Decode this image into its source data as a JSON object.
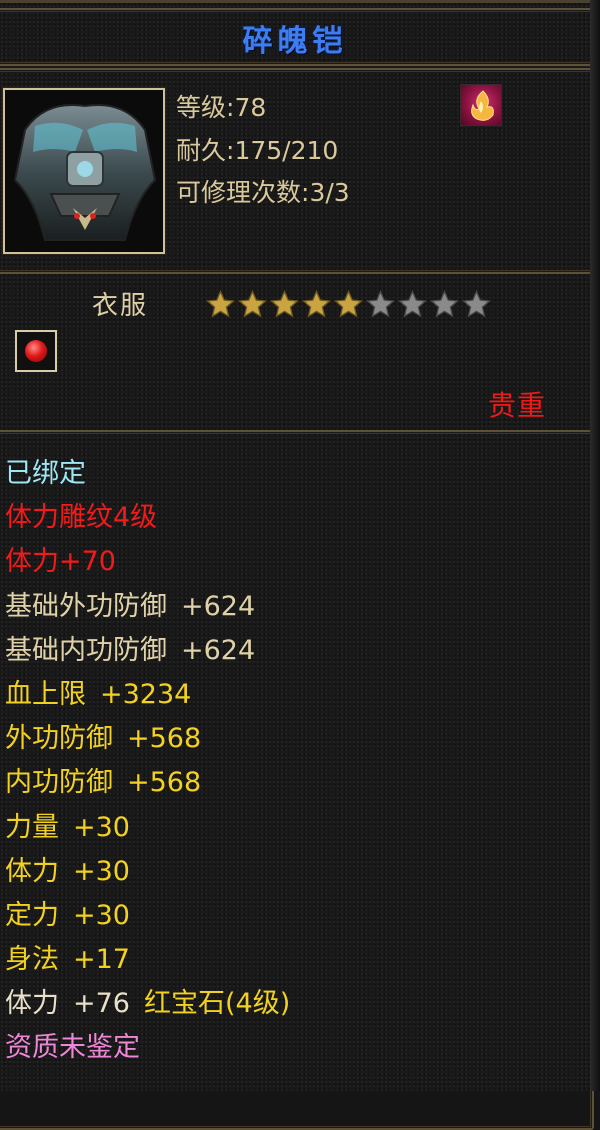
{
  "title": "碎魄铠",
  "header": {
    "level_label": "等级:",
    "level_value": "78",
    "durability_label": "耐久:",
    "durability_value": "175/210",
    "repair_label": "可修理次数:",
    "repair_value": "3/3",
    "quality_icon": "flame-quality-icon"
  },
  "type": {
    "label": "衣服",
    "stars_total": 9,
    "stars_filled": 5,
    "stars_filled_color": "#c9a441",
    "stars_empty_color": "#8a8a8a"
  },
  "socket": {
    "gem_icon": "red-gem-icon",
    "gem_color": "#e01818"
  },
  "bind_note": "贵重",
  "attributes": [
    {
      "text": "已绑定",
      "value": "",
      "style": "bound"
    },
    {
      "text": "体力雕纹4级",
      "value": "",
      "style": "red"
    },
    {
      "text": "体力+70",
      "value": "",
      "style": "red"
    },
    {
      "text": "基础外功防御",
      "value": "+624",
      "style": "base"
    },
    {
      "text": "基础内功防御",
      "value": "+624",
      "style": "base"
    },
    {
      "text": "血上限",
      "value": "+3234",
      "style": "yellow"
    },
    {
      "text": "外功防御",
      "value": "+568",
      "style": "yellow"
    },
    {
      "text": "内功防御",
      "value": "+568",
      "style": "yellow"
    },
    {
      "text": "力量",
      "value": "+30",
      "style": "yellow"
    },
    {
      "text": "体力",
      "value": "+30",
      "style": "yellow"
    },
    {
      "text": "定力",
      "value": "+30",
      "style": "yellow"
    },
    {
      "text": "身法",
      "value": "+17",
      "style": "yellow"
    },
    {
      "text": "体力",
      "value": "+76",
      "gem": "红宝石(4级)",
      "style": "white"
    },
    {
      "text": "资质未鉴定",
      "value": "",
      "style": "pink"
    }
  ],
  "colors": {
    "title": "#3d7df0",
    "label": "#d9c99b",
    "red": "#f21a1a",
    "yellow": "#f3d21f",
    "bound": "#9fe6f5",
    "pink": "#ec86d6",
    "border": "#5d5138"
  }
}
